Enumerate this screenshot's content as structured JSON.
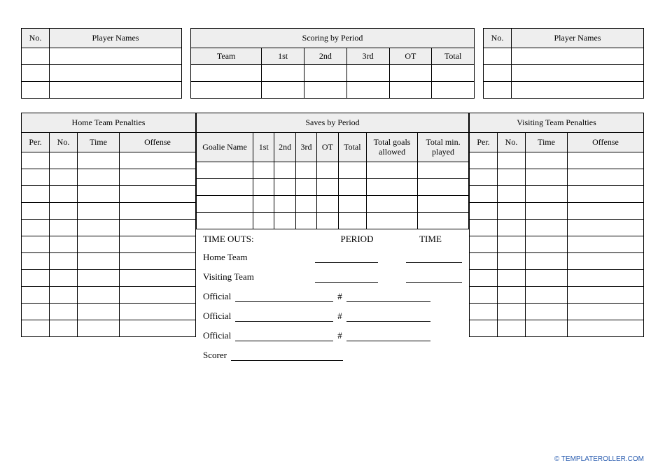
{
  "players": {
    "no": "No.",
    "names": "Player Names"
  },
  "scoring": {
    "title": "Scoring by Period",
    "team": "Team",
    "p1": "1st",
    "p2": "2nd",
    "p3": "3rd",
    "ot": "OT",
    "total": "Total"
  },
  "home_pen": {
    "title": "Home Team Penalties"
  },
  "visit_pen": {
    "title": "Visiting Team Penalties"
  },
  "pen_cols": {
    "per": "Per.",
    "no": "No.",
    "time": "Time",
    "offense": "Offense"
  },
  "saves": {
    "title": "Saves by Period",
    "goalie": "Goalie Name",
    "p1": "1st",
    "p2": "2nd",
    "p3": "3rd",
    "ot": "OT",
    "total": "Total",
    "tg": "Total goals allowed",
    "tm": "Total min. played"
  },
  "timeouts": {
    "header": "TIME OUTS:",
    "period": "PERIOD",
    "time": "TIME",
    "home": "Home Team",
    "visiting": "Visiting Team",
    "official": "Official",
    "hash": "#",
    "scorer": "Scorer"
  },
  "footer": "© TEMPLATEROLLER.COM"
}
